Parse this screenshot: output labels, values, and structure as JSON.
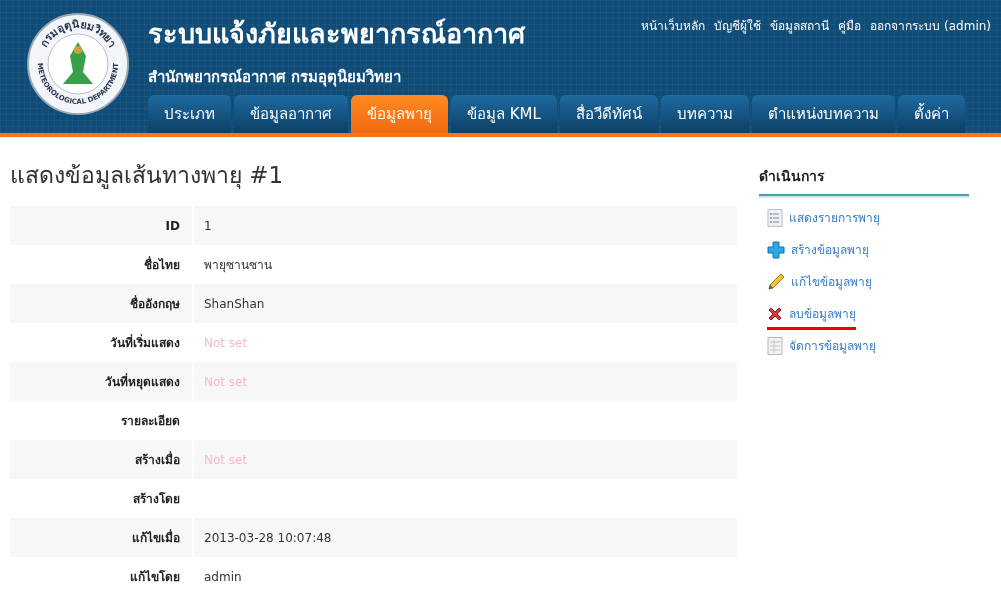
{
  "header": {
    "logo": {
      "top_text": "กรมอุตุนิยมวิทยา",
      "bottom_text": "METEOROLOGICAL DEPARTMENT"
    },
    "title": "ระบบแจ้งภัยและพยากรณ์อากาศ",
    "subtitle": "สำนักพยากรณ์อากาศ กรมอุตุนิยมวิทยา",
    "top_links": [
      "หน้าเว็บหลัก",
      "บัญชีผู้ใช้",
      "ข้อมูลสถานี",
      "คู่มือ",
      "ออกจากระบบ (admin)"
    ],
    "tabs": [
      {
        "label": "ประเภท",
        "selected": false
      },
      {
        "label": "ข้อมูลอากาศ",
        "selected": false
      },
      {
        "label": "ข้อมูลพายุ",
        "selected": true
      },
      {
        "label": "ข้อมูล KML",
        "selected": false
      },
      {
        "label": "สื่อวีดีทัศน์",
        "selected": false
      },
      {
        "label": "บทความ",
        "selected": false
      },
      {
        "label": "ตำแหน่งบทความ",
        "selected": false
      },
      {
        "label": "ตั้งค่า",
        "selected": false
      }
    ]
  },
  "page_title": "แสดงข้อมูลเส้นทางพายุ #1",
  "details": [
    {
      "label": "ID",
      "kind": "text",
      "value": "1"
    },
    {
      "label": "ชื่อไทย",
      "kind": "text",
      "value": "พายุซานซาน"
    },
    {
      "label": "ชื่ออังกฤษ",
      "kind": "text",
      "value": "ShanShan"
    },
    {
      "label": "วันที่เริ่มแสดง",
      "kind": "not_set",
      "value": "Not set"
    },
    {
      "label": "วันที่หยุดแสดง",
      "kind": "not_set",
      "value": "Not set"
    },
    {
      "label": "รายละเอียด",
      "kind": "empty"
    },
    {
      "label": "สร้างเมื่อ",
      "kind": "not_set",
      "value": "Not set"
    },
    {
      "label": "สร้างโดย",
      "kind": "empty"
    },
    {
      "label": "แก้ไขเมื่อ",
      "kind": "text",
      "value": "2013-03-28 10:07:48"
    },
    {
      "label": "แก้ไขโดย",
      "kind": "text",
      "value": "admin"
    }
  ],
  "sidebar": {
    "title": "ดำเนินการ",
    "items": [
      {
        "label": "แสดงรายการพายุ",
        "kind": "list",
        "highlighted": false
      },
      {
        "label": "สร้างข้อมูลพายุ",
        "kind": "create",
        "highlighted": false
      },
      {
        "label": "แก้ไขข้อมูลพายุ",
        "kind": "edit",
        "highlighted": false
      },
      {
        "label": "ลบข้อมูลพายุ",
        "kind": "delete",
        "highlighted": true
      },
      {
        "label": "จัดการข้อมูลพายุ",
        "kind": "manage",
        "highlighted": false
      }
    ]
  }
}
